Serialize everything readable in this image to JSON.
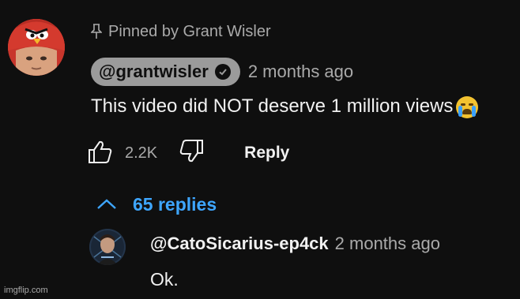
{
  "pinned": {
    "label": "Pinned by Grant Wisler"
  },
  "comment": {
    "author": "@grantwisler",
    "time": "2 months ago",
    "text": "This video did NOT deserve 1 million views",
    "emoji": "loudly-crying-face",
    "likes": "2.2K",
    "reply_label": "Reply"
  },
  "replies_toggle": {
    "label": "65 replies"
  },
  "reply": {
    "author": "@CatoSicarius-ep4ck",
    "time": "2 months ago",
    "text": "Ok."
  },
  "watermark": "imgflip.com",
  "colors": {
    "background": "#0f0f0f",
    "link_blue": "#3ea6ff",
    "secondary_text": "#aaaaaa",
    "author_chip": "#9b9b9b"
  }
}
